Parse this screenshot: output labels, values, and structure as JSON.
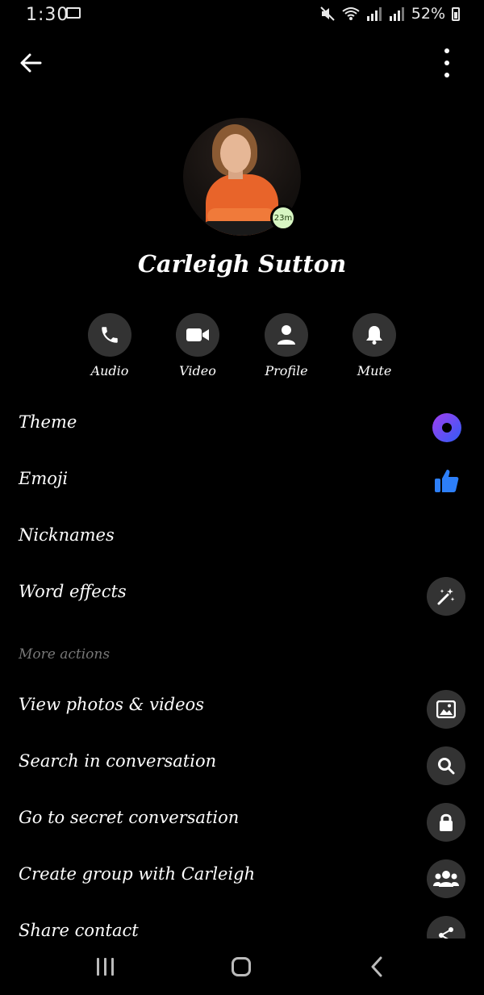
{
  "status_bar": {
    "time": "1:30",
    "battery": "52%"
  },
  "profile": {
    "name": "Carleigh Sutton",
    "active_badge": "23m"
  },
  "actions": [
    {
      "label": "Audio",
      "icon": "phone-icon"
    },
    {
      "label": "Video",
      "icon": "video-camera-icon"
    },
    {
      "label": "Profile",
      "icon": "person-icon"
    },
    {
      "label": "Mute",
      "icon": "bell-icon"
    }
  ],
  "settings": [
    {
      "label": "Theme",
      "icon": "theme-circle-icon"
    },
    {
      "label": "Emoji",
      "icon": "thumbs-up-icon"
    },
    {
      "label": "Nicknames",
      "icon": ""
    },
    {
      "label": "Word effects",
      "icon": "magic-wand-icon"
    }
  ],
  "more_actions": {
    "header": "More actions",
    "items": [
      {
        "label": "View photos & videos",
        "icon": "image-icon"
      },
      {
        "label": "Search in conversation",
        "icon": "search-icon"
      },
      {
        "label": "Go to secret conversation",
        "icon": "lock-icon"
      },
      {
        "label": "Create group with Carleigh",
        "icon": "group-icon"
      },
      {
        "label": "Share contact",
        "icon": "share-icon"
      }
    ]
  },
  "colors": {
    "background": "#000000",
    "icon_circle": "#333333",
    "theme_accent": "#5a3cf0",
    "emoji_blue": "#2d7ff9",
    "muted_text": "#777777"
  }
}
